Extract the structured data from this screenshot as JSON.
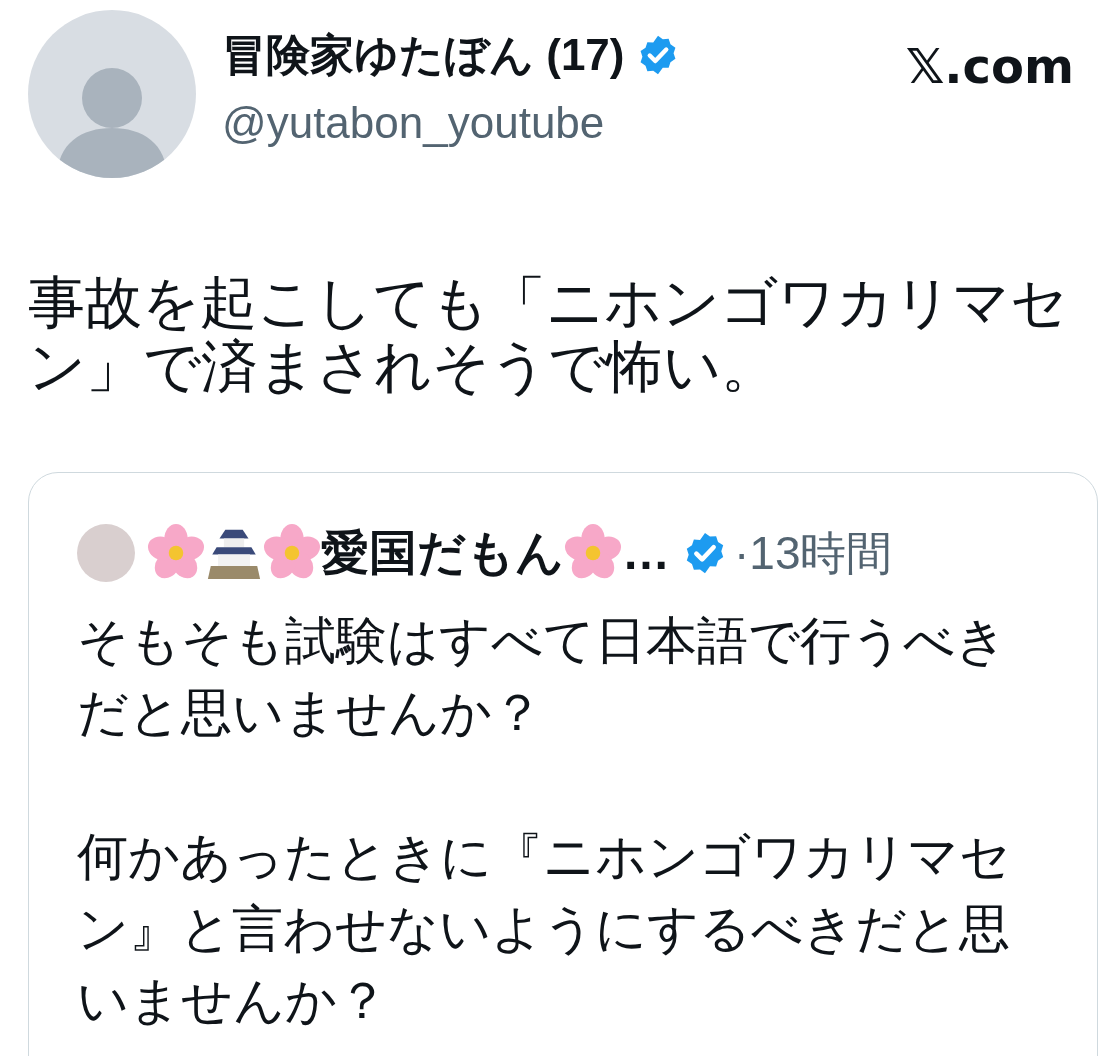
{
  "post": {
    "author_name": "冒険家ゆたぼん (17)",
    "verified": true,
    "handle": "@yutabon_youtube",
    "site": "𝕏.com",
    "text": "事故を起こしても「ニホンゴワカリマセン」で済まされそうで怖い。"
  },
  "quoted_post": {
    "author_name": "愛国だもん",
    "name_ellipsis": "…",
    "verified": true,
    "time": "·13時間",
    "paragraphs": [
      "そもそも試験はすべて日本語で行うべきだと思いませんか？",
      "何かあったときに『ニホンゴワカリマセン』と言わせないようにするべきだと思いませんか？"
    ]
  }
}
